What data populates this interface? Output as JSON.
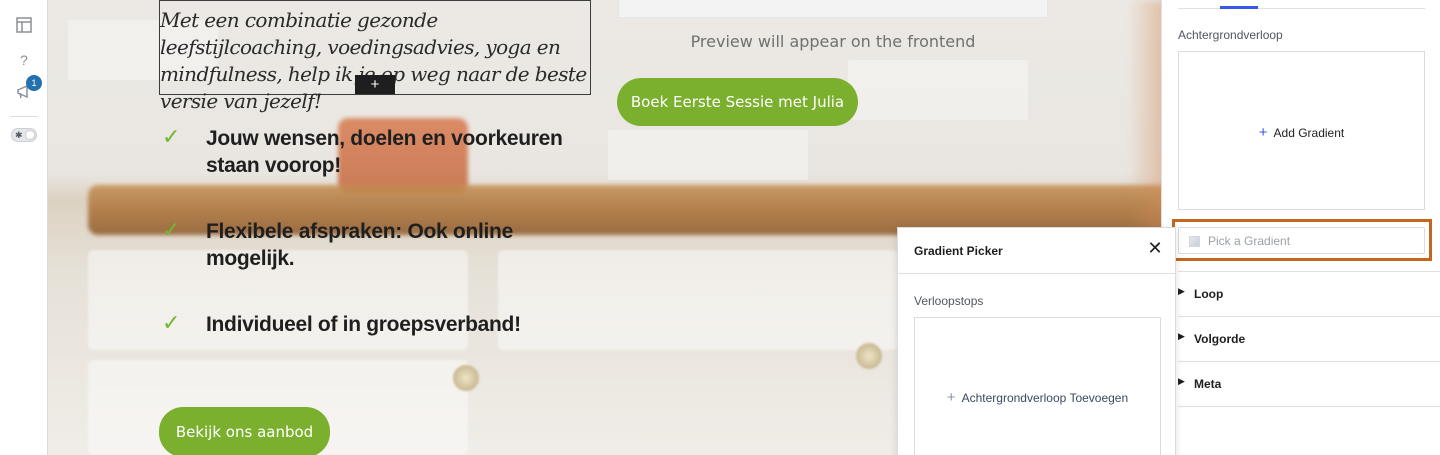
{
  "toolbar": {
    "badge_count": "1",
    "help_label": "?"
  },
  "canvas": {
    "intro_text": "Met een combinatie gezonde leefstijlcoaching, voedingsadvies, yoga en mindfulness, help ik je op weg naar de beste versie van jezelf!",
    "add_block_label": "+",
    "checklist": [
      {
        "mark": "✓",
        "text": "Jouw wensen, doelen en voorkeuren staan voorop!"
      },
      {
        "mark": "✓",
        "text": "Flexibele afspraken: Ook online mogelijk."
      },
      {
        "mark": "✓",
        "text": "Individueel of in groepsverband!"
      }
    ],
    "preview_text": "Preview will appear on the frontend",
    "book_button": "Boek Eerste Sessie met Julia",
    "aanbod_button": "Bekijk ons aanbod"
  },
  "sidebar": {
    "gradient_label": "Achtergrondverloop",
    "add_gradient": "Add Gradient",
    "pick_placeholder": "Pick a Gradient",
    "sections": [
      "Loop",
      "Volgorde",
      "Meta"
    ]
  },
  "popover": {
    "title": "Gradient Picker",
    "close": "✕",
    "stops_label": "Verloopstops",
    "add_stop": "Achtergrondverloop Toevoegen"
  },
  "colors": {
    "accent_green": "#7ab02e",
    "highlight_orange": "#c4661f",
    "wp_blue": "#3858e9"
  }
}
